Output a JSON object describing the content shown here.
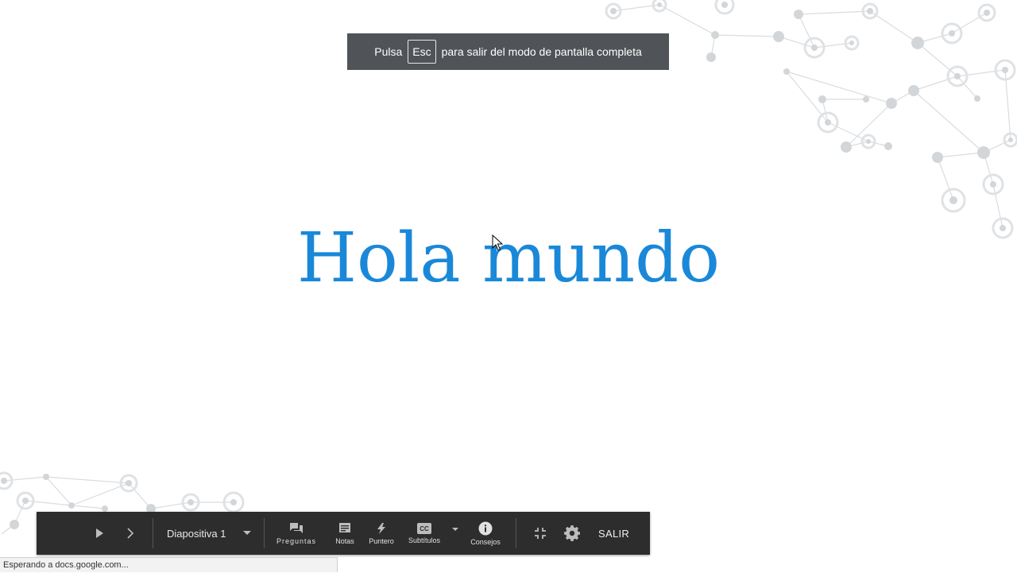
{
  "slide": {
    "title": "Hola mundo",
    "title_color": "#1a88d8"
  },
  "fullscreen_banner": {
    "prefix": "Pulsa",
    "key": "Esc",
    "suffix": "para salir del modo de pantalla completa"
  },
  "toolbar": {
    "play_icon": "play-icon",
    "next_icon": "chevron-right-icon",
    "slide_selector": "Diapositiva 1",
    "buttons": [
      {
        "icon": "questions-icon",
        "label": "Preguntas"
      },
      {
        "icon": "notes-icon",
        "label": "Notas"
      },
      {
        "icon": "pointer-icon",
        "label": "Puntero"
      },
      {
        "icon": "captions-icon",
        "label": "Subtítulos"
      },
      {
        "icon": "info-icon",
        "label": "Consejos"
      }
    ],
    "exit_label": "SALIR"
  },
  "status_bar": {
    "text": "Esperando a docs.google.com..."
  }
}
